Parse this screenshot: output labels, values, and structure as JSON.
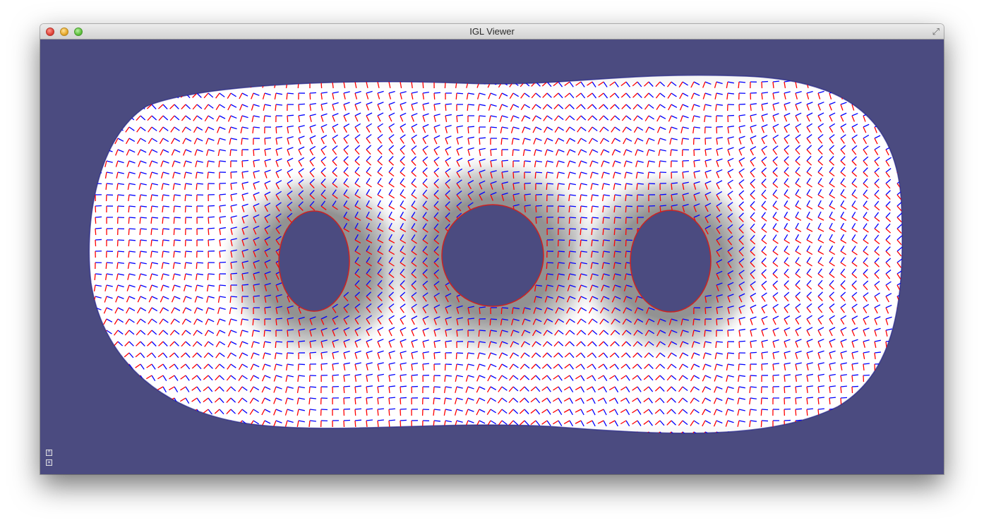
{
  "window": {
    "title": "IGL Viewer",
    "buttons": {
      "close": "close-icon",
      "minimize": "minimize-icon",
      "zoom": "zoom-icon",
      "fullscreen": "fullscreen-icon"
    }
  },
  "viewport": {
    "background_color": "#4b4b80",
    "mesh": {
      "name": "three-hole torus",
      "holes": 3,
      "surface_color": "#ffffff"
    },
    "cross_field": {
      "colors": {
        "primary": "#ff0000",
        "secondary": "#0000ff"
      }
    }
  },
  "toolbar_icons": [
    "collapse-icon",
    "edit-icon"
  ]
}
